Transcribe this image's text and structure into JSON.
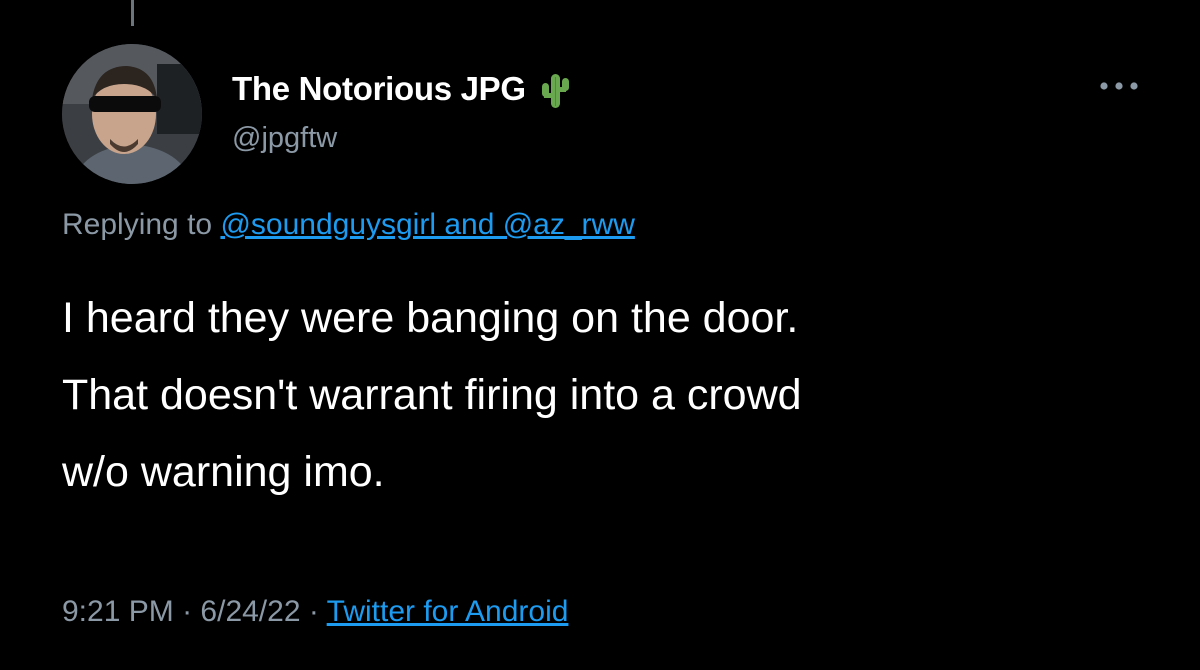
{
  "tweet": {
    "author": {
      "display_name": "The Notorious JPG",
      "name_emoji": "cactus-icon",
      "handle": "@jpgftw"
    },
    "menu_icon": "more-horizontal-icon",
    "reply_context": {
      "prefix": "Replying to",
      "mentions_text": "@soundguysgirl and @az_rww"
    },
    "text_lines": [
      "I heard they were banging on the door.",
      "That doesn't warrant firing into a crowd",
      "w/o warning imo."
    ],
    "meta": {
      "time": "9:21 PM",
      "separator": "·",
      "date": "6/24/22",
      "source": "Twitter for Android"
    }
  },
  "colors": {
    "background": "#000000",
    "primary_text": "#ffffff",
    "secondary_text": "#8b98a5",
    "link": "#1d9bf0"
  }
}
